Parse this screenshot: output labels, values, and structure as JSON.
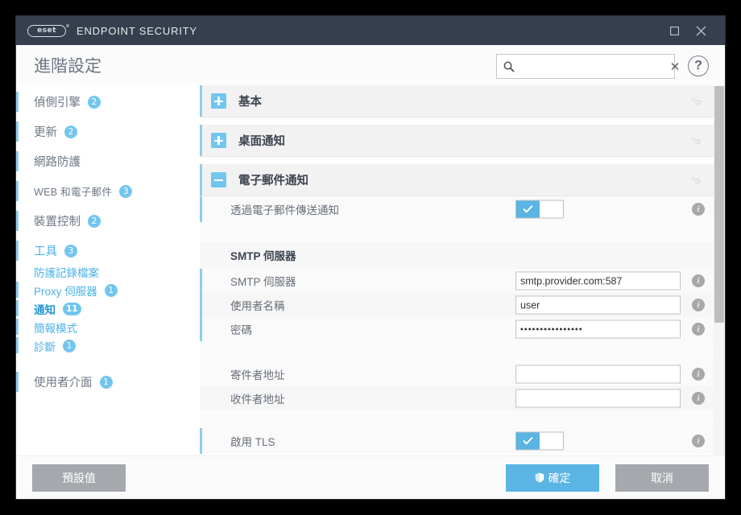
{
  "window": {
    "app_title": "ENDPOINT SECURITY",
    "logo_text": "eset",
    "logo_tm": "®",
    "controls": [
      {
        "name": "maximize-button",
        "icon": "square-icon"
      },
      {
        "name": "close-button",
        "icon": "close-icon"
      }
    ]
  },
  "header": {
    "page_title": "進階設定",
    "search": {
      "value": "",
      "placeholder": "",
      "icon": "search-icon",
      "clear_label": "✕"
    },
    "help_label": "?"
  },
  "sidebar": {
    "items": [
      {
        "label": "偵側引擎",
        "badge": "2",
        "type": "group",
        "latin": false
      },
      {
        "label": "更新",
        "badge": "2",
        "type": "group",
        "latin": false
      },
      {
        "label": "網路防護",
        "badge": "",
        "type": "group",
        "latin": false
      },
      {
        "label": "WEB 和電子郵件",
        "badge": "3",
        "type": "group",
        "latin": true
      },
      {
        "label": "裝置控制",
        "badge": "2",
        "type": "group",
        "latin": false
      },
      {
        "label": "工具",
        "badge": "3",
        "type": "group",
        "latin": false,
        "active_parent": true
      },
      {
        "label": "防護記錄檔案",
        "badge": "",
        "type": "sub",
        "nobar": true
      },
      {
        "label": "Proxy 伺服器",
        "badge": "1",
        "type": "sub"
      },
      {
        "label": "通知",
        "badge": "11",
        "type": "sub",
        "active": true
      },
      {
        "label": "簡報模式",
        "badge": "",
        "type": "sub"
      },
      {
        "label": "診斷",
        "badge": "1",
        "type": "sub"
      },
      {
        "label": "使用者介面",
        "badge": "1",
        "type": "group"
      }
    ]
  },
  "content": {
    "sections": [
      {
        "title": "基本",
        "state": "collapsed",
        "icon": "plus-icon",
        "revert": "revert-icon"
      },
      {
        "title": "桌面通知",
        "state": "collapsed",
        "icon": "plus-icon",
        "revert": "revert-icon"
      },
      {
        "title": "電子郵件通知",
        "state": "expanded",
        "icon": "minus-icon",
        "revert": "revert-icon"
      }
    ],
    "rows": [
      {
        "label": "透過電子郵件傳送通知",
        "control": "toggle",
        "value": "on",
        "info": "info-icon"
      }
    ],
    "smtp_group_title": "SMTP 伺服器",
    "smtp_rows": [
      {
        "label": "SMTP 伺服器",
        "control": "text",
        "value": "smtp.provider.com:587",
        "placeholder": "",
        "info": "info-icon"
      },
      {
        "label": "使用者名稱",
        "control": "text",
        "value": "user",
        "placeholder": "",
        "info": "info-icon"
      },
      {
        "label": "密碼",
        "control": "password",
        "value": "••••••••••••••••",
        "placeholder": "",
        "info": "info-icon"
      }
    ],
    "address_rows": [
      {
        "label": "寄件者地址",
        "control": "text",
        "value": "",
        "placeholder": "",
        "info": "info-icon"
      },
      {
        "label": "收件者地址",
        "control": "text",
        "value": "",
        "placeholder": "",
        "info": "info-icon"
      }
    ],
    "partial_row": {
      "label": "啟用 TLS",
      "control": "toggle",
      "value": "on",
      "info": "info-icon"
    },
    "scrollbar": {
      "name": "vertical-scrollbar",
      "thumb_position": "top"
    }
  },
  "footer": {
    "default_label": "預設值",
    "ok_label": "確定",
    "ok_icon": "shield-icon",
    "cancel_label": "取消"
  },
  "colors": {
    "accent": "#5ab4e4",
    "accent_light": "#8fcdee",
    "titlebar": "#353f4d",
    "link": "#4db2e8",
    "gray_button": "#a5a9ad"
  }
}
